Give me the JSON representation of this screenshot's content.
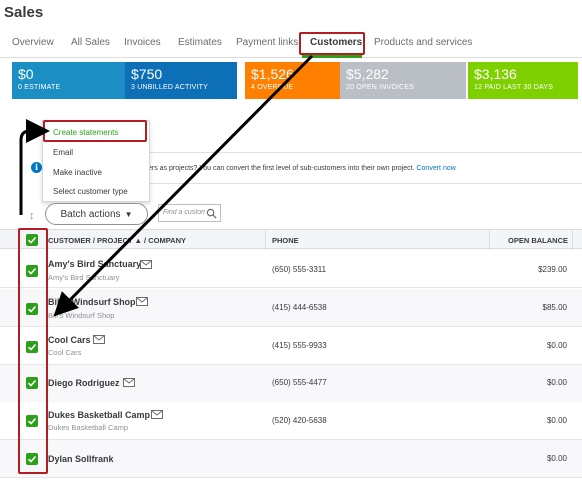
{
  "page": {
    "title": "Sales"
  },
  "tabs": [
    {
      "label": "Overview"
    },
    {
      "label": "All Sales"
    },
    {
      "label": "Invoices"
    },
    {
      "label": "Estimates"
    },
    {
      "label": "Payment links"
    },
    {
      "label": "Customers"
    },
    {
      "label": "Products and services"
    }
  ],
  "money_bar": [
    {
      "amount": "$0",
      "label": "0 ESTIMATE",
      "color": "#1b8fc4"
    },
    {
      "amount": "$750",
      "label": "3 UNBILLED ACTIVITY",
      "color": "#0d6fb5"
    },
    {
      "amount": "$1,526",
      "label": "4 OVERDUE",
      "color": "#ff8000"
    },
    {
      "amount": "$5,282",
      "label": "20 OPEN INVOICES",
      "color": "#babec5"
    },
    {
      "amount": "$3,136",
      "label": "12 PAID LAST 30 DAYS",
      "color": "#7fd000"
    }
  ],
  "batch_menu": {
    "items": [
      "Create statements",
      "Email",
      "Make inactive",
      "Select customer type"
    ]
  },
  "banner": {
    "text": "ers as projects? You can convert the first level of sub-customers into their own project.",
    "link": "Convert now"
  },
  "toolbar": {
    "batch_label": "Batch actions",
    "batch_arrow": "▼",
    "search_placeholder": "Find a customer"
  },
  "table": {
    "columns": {
      "customer": "CUSTOMER / PROJECT ▲ / COMPANY",
      "phone": "PHONE",
      "balance": "OPEN BALANCE"
    },
    "rows": [
      {
        "name": "Amy's Bird Sanctuary",
        "sub": "Amy's Bird Sanctuary",
        "phone": "(650) 555-3311",
        "balance": "$239.00"
      },
      {
        "name": "Bill's Windsurf Shop",
        "sub": "Bill's Windsurf Shop",
        "phone": "(415) 444-6538",
        "balance": "$85.00"
      },
      {
        "name": "Cool Cars",
        "sub": "Cool Cars",
        "phone": "(415) 555-9933",
        "balance": "$0.00"
      },
      {
        "name": "Diego Rodriguez",
        "sub": "",
        "phone": "(650) 555-4477",
        "balance": "$0.00"
      },
      {
        "name": "Dukes Basketball Camp",
        "sub": "Dukes Basketball Camp",
        "phone": "(520) 420-5638",
        "balance": "$0.00"
      },
      {
        "name": "Dylan Sollfrank",
        "sub": "",
        "phone": "",
        "balance": "$0.00"
      }
    ]
  },
  "accent": {
    "green": "#2ca01c",
    "highlight": "#b41e23",
    "link": "#0077c5"
  }
}
